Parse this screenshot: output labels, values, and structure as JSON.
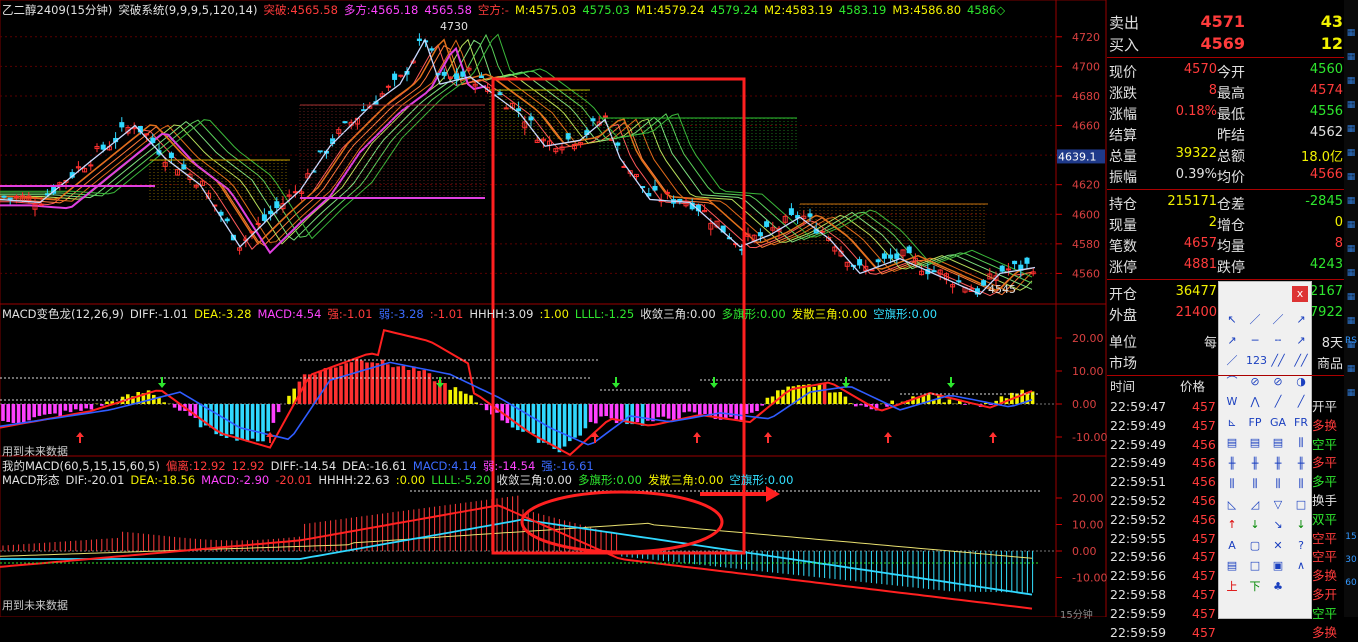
{
  "main_header": {
    "symbol": "乙二醇2409(15分钟)",
    "indicator": "突破系统(9,9,9,5,120,14)",
    "items": [
      {
        "label": "突破:",
        "value": "4565.58",
        "color": "#ff3b3b"
      },
      {
        "label": "多方:",
        "value": "4565.18",
        "color": "#ff44ff"
      },
      {
        "label": "",
        "value": "4565.58",
        "color": "#ff44ff"
      },
      {
        "label": "空方:",
        "value": "-",
        "color": "#ff3b3b"
      },
      {
        "label": "M:",
        "value": "4575.03",
        "color": "#f2f200"
      },
      {
        "label": "",
        "value": "4575.03",
        "color": "#2ee62e"
      },
      {
        "label": "M1:",
        "value": "4579.24",
        "color": "#f2f200"
      },
      {
        "label": "",
        "value": "4579.24",
        "color": "#2ee62e"
      },
      {
        "label": "M2:",
        "value": "4583.19",
        "color": "#f2f200"
      },
      {
        "label": "",
        "value": "4583.19",
        "color": "#2ee62e"
      },
      {
        "label": "M3:",
        "value": "4586.80",
        "color": "#f2f200"
      },
      {
        "label": "",
        "value": "4586◇",
        "color": "#2ee62e"
      }
    ]
  },
  "main_yaxis": [
    "4720",
    "4700",
    "4680",
    "4660",
    "4640",
    "4620",
    "4600",
    "4580",
    "4560"
  ],
  "cursor_price": "4639.1",
  "high_label": "4730",
  "low_label": "4545",
  "macd1_header": {
    "title": "MACD变色龙(12,26,9)",
    "items": [
      {
        "label": "DIFF:",
        "value": "-1.01",
        "color": "#e0e0e0"
      },
      {
        "label": "DEA:",
        "value": "-3.28",
        "color": "#f2f200"
      },
      {
        "label": "MACD:",
        "value": "4.54",
        "color": "#ff44ff"
      },
      {
        "label": "强:",
        "value": "-1.01",
        "color": "#ff3b3b"
      },
      {
        "label": "弱:",
        "value": "-3.28",
        "color": "#3b6bff"
      },
      {
        "label": ":",
        "value": "-1.01",
        "color": "#ff3b3b"
      },
      {
        "label": "HHHH:",
        "value": "3.09",
        "color": "#e0e0e0"
      },
      {
        "label": ":",
        "value": "1.00",
        "color": "#f2f200"
      },
      {
        "label": "LLLL:",
        "value": "-1.25",
        "color": "#2ee62e"
      },
      {
        "label": "收敛三角:",
        "value": "0.00",
        "color": "#e0e0e0"
      },
      {
        "label": "多旗形:",
        "value": "0.00",
        "color": "#2ee62e"
      },
      {
        "label": "发散三角:",
        "value": "0.00",
        "color": "#f2f200"
      },
      {
        "label": "空旗形:",
        "value": "0.00",
        "color": "#33e0ff"
      }
    ]
  },
  "macd1_yaxis": [
    "20.00",
    "10.00",
    "0.00",
    "-10.00"
  ],
  "future_data_label": "用到未来数据",
  "macd2_header_line1": {
    "title": "我的MACD(60,5,15,15,60,5)",
    "items": [
      {
        "label": "偏离:",
        "value": "12.92",
        "color": "#ff3b3b"
      },
      {
        "label": "",
        "value": "12.92",
        "color": "#ff3b3b"
      },
      {
        "label": "DIFF:",
        "value": "-14.54",
        "color": "#e0e0e0"
      },
      {
        "label": "DEA:",
        "value": "-16.61",
        "color": "#e0e0e0"
      },
      {
        "label": "MACD:",
        "value": "4.14",
        "color": "#3b6bff"
      },
      {
        "label": "弱:",
        "value": "-14.54",
        "color": "#ff44ff"
      },
      {
        "label": "强:",
        "value": "-16.61",
        "color": "#3b6bff"
      }
    ]
  },
  "macd2_header_line2": {
    "title": "MACD形态",
    "items": [
      {
        "label": "DIF:",
        "value": "-20.01",
        "color": "#e0e0e0"
      },
      {
        "label": "DEA:",
        "value": "-18.56",
        "color": "#f2f200"
      },
      {
        "label": "MACD:",
        "value": "-2.90",
        "color": "#ff44ff"
      },
      {
        "label": "",
        "value": "-20.01",
        "color": "#ff3b3b"
      },
      {
        "label": "HHHH:",
        "value": "22.63",
        "color": "#e0e0e0"
      },
      {
        "label": ":",
        "value": "0.00",
        "color": "#f2f200"
      },
      {
        "label": "LLLL:",
        "value": "-5.20",
        "color": "#2ee62e"
      },
      {
        "label": "收敛三角:",
        "value": "0.00",
        "color": "#e0e0e0"
      },
      {
        "label": "多旗形:",
        "value": "0.00",
        "color": "#2ee62e"
      },
      {
        "label": "发散三角:",
        "value": "0.00",
        "color": "#f2f200"
      },
      {
        "label": "空旗形:",
        "value": "0.00",
        "color": "#33e0ff"
      }
    ]
  },
  "macd2_yaxis": [
    "20.00",
    "10.00",
    "0.00",
    "-10.00"
  ],
  "time_axis_tail": "15分钟",
  "quote": {
    "sell": {
      "label": "卖出",
      "price": "4571",
      "qty": "43"
    },
    "buy": {
      "label": "买入",
      "price": "4569",
      "qty": "12"
    },
    "rows": [
      {
        "l1": "现价",
        "v1": "4570",
        "c1": "#ff3b3b",
        "l2": "今开",
        "v2": "4560",
        "c2": "#2ee62e"
      },
      {
        "l1": "涨跌",
        "v1": "8",
        "c1": "#ff3b3b",
        "l2": "最高",
        "v2": "4574",
        "c2": "#ff3b3b"
      },
      {
        "l1": "涨幅",
        "v1": "0.18%",
        "c1": "#ff3b3b",
        "l2": "最低",
        "v2": "4556",
        "c2": "#2ee62e"
      },
      {
        "l1": "结算",
        "v1": "",
        "c1": "#e0e0e0",
        "l2": "昨结",
        "v2": "4562",
        "c2": "#e0e0e0"
      },
      {
        "l1": "总量",
        "v1": "39322",
        "c1": "#f2f200",
        "l2": "总额",
        "v2": "18.0亿",
        "c2": "#f2f200"
      },
      {
        "l1": "振幅",
        "v1": "0.39%",
        "c1": "#e0e0e0",
        "l2": "均价",
        "v2": "4566",
        "c2": "#ff3b3b"
      },
      {
        "l1": "持仓",
        "v1": "215171",
        "c1": "#f2f200",
        "l2": "仓差",
        "v2": "-2845",
        "c2": "#2ee62e"
      },
      {
        "l1": "现量",
        "v1": "2",
        "c1": "#f2f200",
        "l2": "增仓",
        "v2": "0",
        "c2": "#f2f200"
      },
      {
        "l1": "笔数",
        "v1": "4657",
        "c1": "#ff3b3b",
        "l2": "均量",
        "v2": "8",
        "c2": "#ff3b3b"
      },
      {
        "l1": "涨停",
        "v1": "4881",
        "c1": "#ff3b3b",
        "l2": "跌停",
        "v2": "4243",
        "c2": "#2ee62e"
      },
      {
        "l1": "开仓",
        "v1": "36477",
        "c1": "#f2f200",
        "l2": "",
        "v2": "2167",
        "c2": "#2ee62e"
      },
      {
        "l1": "外盘",
        "v1": "21400",
        "c1": "#ff3b3b",
        "l2": "",
        "v2": "7922",
        "c2": "#2ee62e"
      },
      {
        "l1": "单位",
        "v1": "每",
        "c1": "#e0e0e0",
        "l2": "",
        "v2": "8天",
        "c2": "#e0e0e0"
      },
      {
        "l1": "市场",
        "v1": "",
        "c1": "#e0e0e0",
        "l2": "",
        "v2": "商品",
        "c2": "#e0e0e0"
      }
    ],
    "trade_header": {
      "time": "时间",
      "price": "价格"
    },
    "trades": [
      {
        "time": "22:59:47",
        "price": "457",
        "flag": "开平",
        "fc": "#e0e0e0"
      },
      {
        "time": "22:59:49",
        "price": "457",
        "flag": "多换",
        "fc": "#ff3b3b"
      },
      {
        "time": "22:59:49",
        "price": "456",
        "flag": "空平",
        "fc": "#2ee62e"
      },
      {
        "time": "22:59:49",
        "price": "456",
        "flag": "多平",
        "fc": "#ff3b3b"
      },
      {
        "time": "22:59:51",
        "price": "456",
        "flag": "多平",
        "fc": "#2ee62e"
      },
      {
        "time": "22:59:52",
        "price": "456",
        "flag": "换手",
        "fc": "#e0e0e0"
      },
      {
        "time": "22:59:52",
        "price": "456",
        "flag": "双平",
        "fc": "#2ee62e"
      },
      {
        "time": "22:59:55",
        "price": "457",
        "flag": "空平",
        "fc": "#ff3b3b"
      },
      {
        "time": "22:59:56",
        "price": "457",
        "flag": "空平",
        "fc": "#ff3b3b"
      },
      {
        "time": "22:59:56",
        "price": "457",
        "flag": "多换",
        "fc": "#ff3b3b"
      },
      {
        "time": "22:59:58",
        "price": "457",
        "flag": "多开",
        "fc": "#ff3b3b"
      },
      {
        "time": "22:59:59",
        "price": "457",
        "flag": "空平",
        "fc": "#2ee62e"
      },
      {
        "time": "22:59:59",
        "price": "457",
        "flag": "多换",
        "fc": "#ff3b3b"
      }
    ]
  },
  "side_tabs": [
    "RS",
    "15",
    "30",
    "60"
  ],
  "toolbox": {
    "close": "x",
    "tools": [
      "↖",
      "／",
      "／",
      "↗",
      "↗",
      "─",
      "╌",
      "↗",
      "／",
      "123",
      "╱╱",
      "╱╱",
      "⌒",
      "⊘",
      "⊘",
      "◑",
      "W",
      "⋀",
      "╱",
      "╱",
      "⊾",
      "FP",
      "GA",
      "FR",
      "▤",
      "▤",
      "▤",
      "⫼",
      "╫",
      "╫",
      "╫",
      "╫",
      "⫼",
      "⫼",
      "⫼",
      "⫼",
      "◺",
      "◿",
      "▽",
      "□",
      "↑",
      "↓",
      "↘",
      "↓",
      "A",
      "▢",
      "✕",
      "?",
      "▤",
      "□",
      "▣",
      "∧",
      "上",
      "下",
      "♣",
      ""
    ]
  }
}
